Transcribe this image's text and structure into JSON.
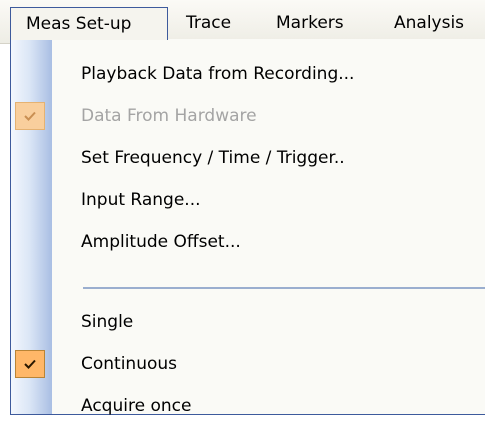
{
  "menubar": {
    "items": [
      {
        "label": "Meas Set-up"
      },
      {
        "label": "Trace"
      },
      {
        "label": "Markers"
      },
      {
        "label": "Analysis"
      }
    ]
  },
  "dropdown": {
    "items": [
      {
        "label": "Playback Data from Recording...",
        "enabled": true,
        "checked": false
      },
      {
        "label": "Data From Hardware",
        "enabled": false,
        "checked": true
      },
      {
        "label": "Set Frequency / Time / Trigger..",
        "enabled": true,
        "checked": false
      },
      {
        "label": "Input Range...",
        "enabled": true,
        "checked": false
      },
      {
        "label": "Amplitude Offset...",
        "enabled": true,
        "checked": false
      },
      {
        "label": "Single",
        "enabled": true,
        "checked": false
      },
      {
        "label": "Continuous",
        "enabled": true,
        "checked": true
      },
      {
        "label": "Acquire once",
        "enabled": true,
        "checked": false
      }
    ]
  },
  "icons": {
    "check": "check-icon"
  },
  "colors": {
    "menu_border": "#3d5a9c",
    "check_bg": "#ffb768",
    "check_bg_disabled": "#f9cf9d",
    "disabled_text": "#a4a4a4"
  }
}
